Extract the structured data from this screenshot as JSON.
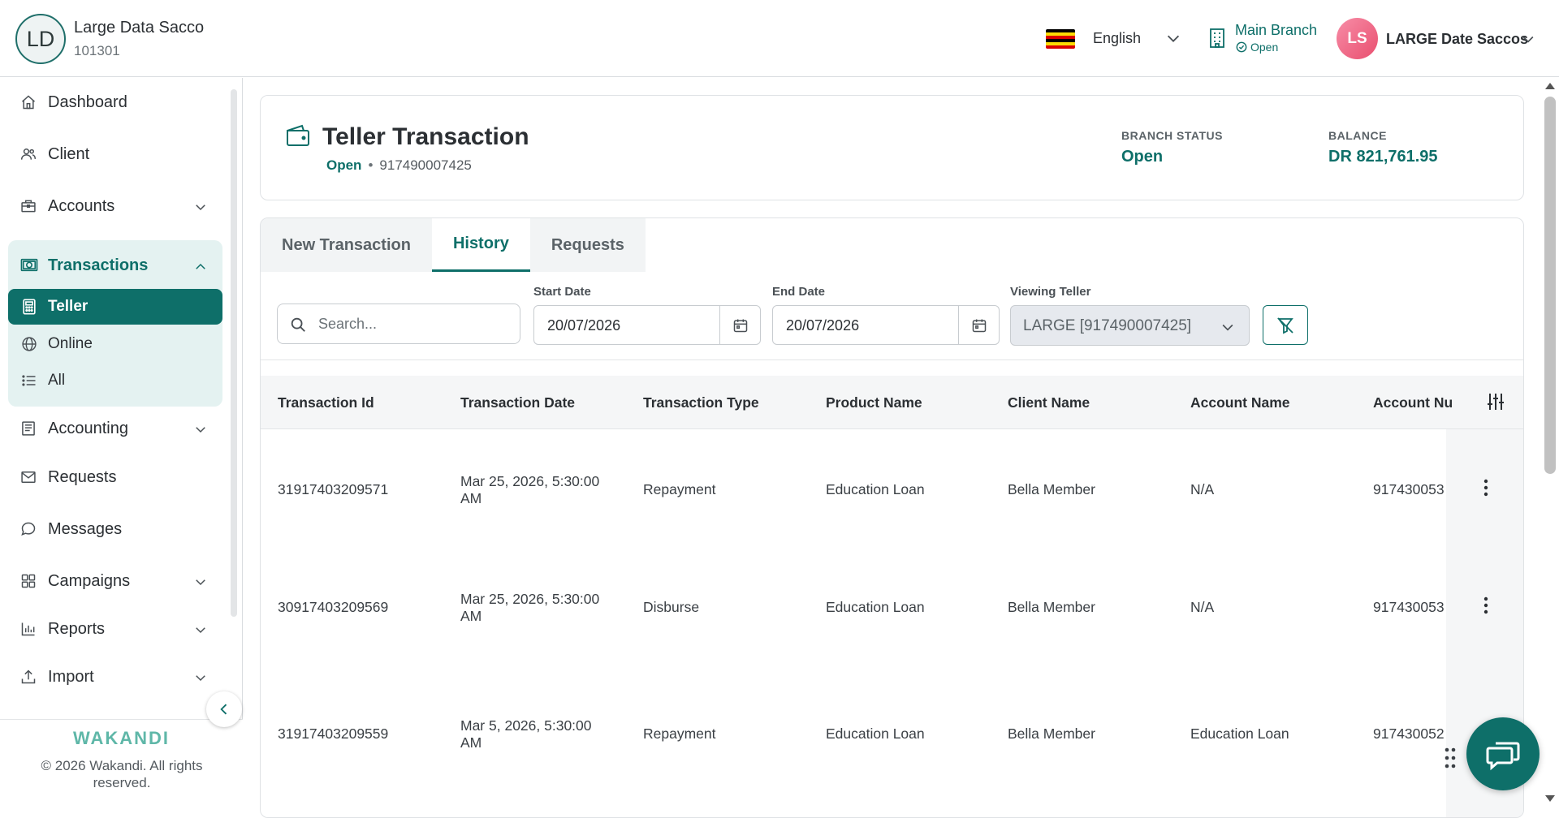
{
  "header": {
    "org_initials": "LD",
    "org_name": "Large Data Sacco",
    "org_code": "101301",
    "language": "English",
    "branch_name": "Main Branch",
    "branch_status": "Open",
    "user_initials": "LS",
    "user_name": "LARGE Date Saccos"
  },
  "sidebar": {
    "items": [
      {
        "label": "Dashboard",
        "icon": "home-icon"
      },
      {
        "label": "Client",
        "icon": "users-icon"
      },
      {
        "label": "Accounts",
        "icon": "briefcase-icon"
      },
      {
        "label": "Transactions",
        "icon": "cash-icon"
      },
      {
        "label": "Accounting",
        "icon": "ledger-icon"
      },
      {
        "label": "Requests",
        "icon": "mail-icon"
      },
      {
        "label": "Messages",
        "icon": "chat-icon"
      },
      {
        "label": "Campaigns",
        "icon": "grid-icon"
      },
      {
        "label": "Reports",
        "icon": "bar-chart-icon"
      },
      {
        "label": "Import",
        "icon": "upload-icon"
      }
    ],
    "transactions_sub": [
      "Teller",
      "Online",
      "All"
    ],
    "brand": "WAKANDI",
    "copyright": "© 2026 Wakandi. All rights reserved."
  },
  "page": {
    "title": "Teller Transaction",
    "status": "Open",
    "account_number": "917490007425",
    "branch_status_label": "BRANCH STATUS",
    "branch_status_value": "Open",
    "balance_label": "BALANCE",
    "balance_value": "DR 821,761.95"
  },
  "tabs": [
    "New Transaction",
    "History",
    "Requests"
  ],
  "active_tab": "History",
  "filters": {
    "search_placeholder": "Search...",
    "start_date_label": "Start Date",
    "start_date": "20/07/2026",
    "end_date_label": "End Date",
    "end_date": "20/07/2026",
    "viewing_teller_label": "Viewing Teller",
    "viewing_teller": "LARGE [917490007425]"
  },
  "table": {
    "columns": [
      "Transaction Id",
      "Transaction Date",
      "Transaction Type",
      "Product Name",
      "Client Name",
      "Account Name",
      "Account Nu"
    ],
    "rows": [
      {
        "id": "31917403209571",
        "date_line1": "Mar 25, 2026, 5:30:00",
        "date_line2": "AM",
        "type": "Repayment",
        "product": "Education Loan",
        "client": "Bella Member",
        "account_name": "N/A",
        "account_number": "917430053"
      },
      {
        "id": "30917403209569",
        "date_line1": "Mar 25, 2026, 5:30:00",
        "date_line2": "AM",
        "type": "Disburse",
        "product": "Education Loan",
        "client": "Bella Member",
        "account_name": "N/A",
        "account_number": "917430053"
      },
      {
        "id": "31917403209559",
        "date_line1": "Mar 5, 2026, 5:30:00",
        "date_line2": "AM",
        "type": "Repayment",
        "product": "Education Loan",
        "client": "Bella Member",
        "account_name": "Education Loan",
        "account_number": "917430052"
      }
    ]
  },
  "colors": {
    "primary": "#0e6f69",
    "primary_light": "#e4f2f1",
    "avatar_pink": "#e94f6f"
  }
}
